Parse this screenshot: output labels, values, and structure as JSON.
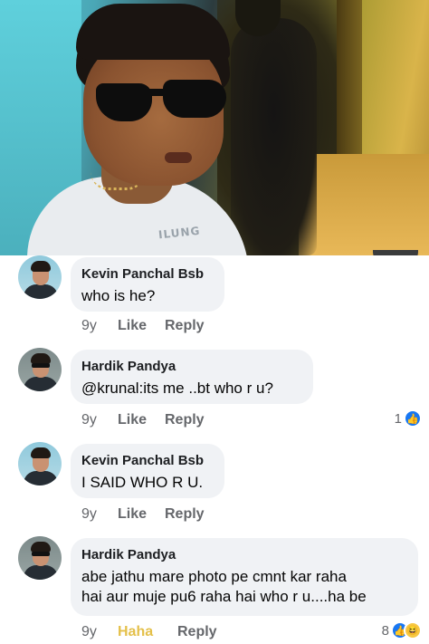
{
  "photo": {
    "shirt_text": "ILUNG"
  },
  "comments": [
    {
      "name": "Kevin Panchal Bsb",
      "text": "who is he?",
      "time": "9y",
      "like": "Like",
      "reply": "Reply"
    },
    {
      "name": "Hardik Pandya",
      "text": "@krunal:its me ..bt who r u?",
      "time": "9y",
      "like": "Like",
      "reply": "Reply",
      "reactions": "1"
    },
    {
      "name": "Kevin Panchal Bsb",
      "text": "I SAID WHO R U.",
      "time": "9y",
      "like": "Like",
      "reply": "Reply"
    },
    {
      "name": "Hardik Pandya",
      "text_line1": "abe jathu mare photo pe cmnt kar raha",
      "text_line2": "hai aur muje pu6 raha hai who r u....ha be",
      "time": "9y",
      "like": "Haha",
      "reply": "Reply",
      "reactions": "8"
    }
  ],
  "colors": {
    "like_blue": "#1877f2",
    "haha_yellow": "#e4c04a",
    "bubble": "#f0f2f5"
  },
  "icons": {
    "like": "thumbs-up-icon",
    "haha": "laughing-face-icon"
  }
}
